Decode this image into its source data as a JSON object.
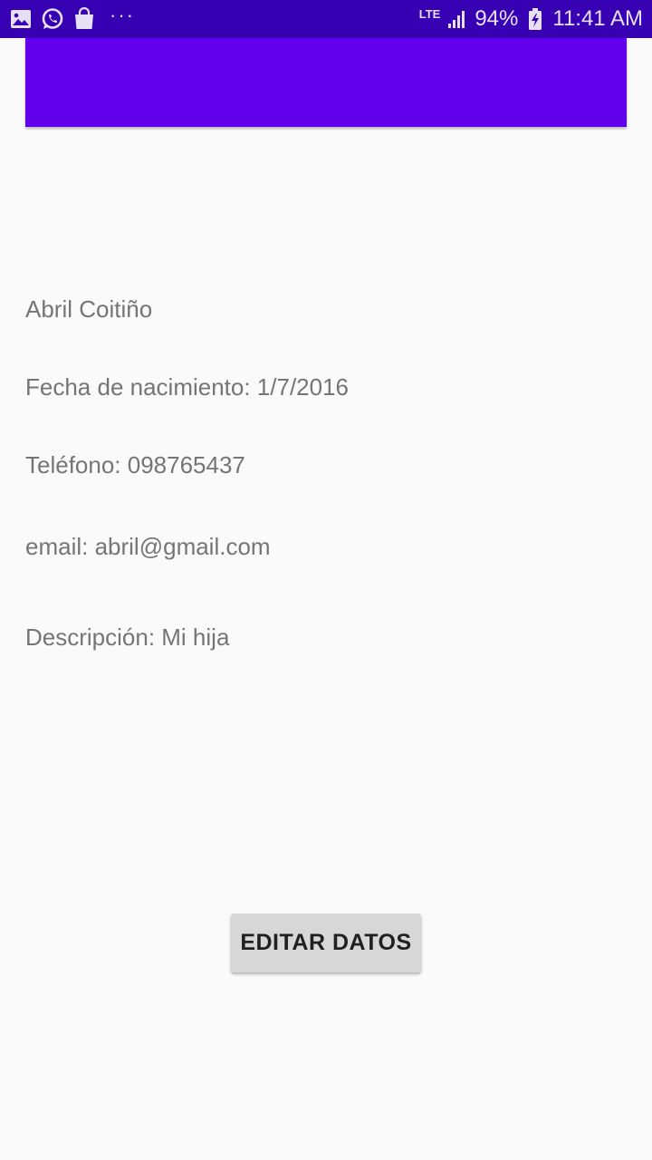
{
  "status_bar": {
    "icons_left": [
      "gallery-icon",
      "whatsapp-icon",
      "shopping-bag-icon",
      "more-dots-icon"
    ],
    "more_label": "···",
    "network": "LTE",
    "battery": "94%",
    "time": "11:41 AM",
    "background_color": "#3700b3"
  },
  "header": {
    "color": "#6200ee"
  },
  "details": {
    "name": "Abril Coitiño",
    "birth_date": "Fecha de nacimiento: 1/7/2016",
    "phone": "Teléfono: 098765437",
    "email": "email: abril@gmail.com",
    "description": "Descripción: Mi hija"
  },
  "actions": {
    "edit_label": "EDITAR DATOS"
  }
}
